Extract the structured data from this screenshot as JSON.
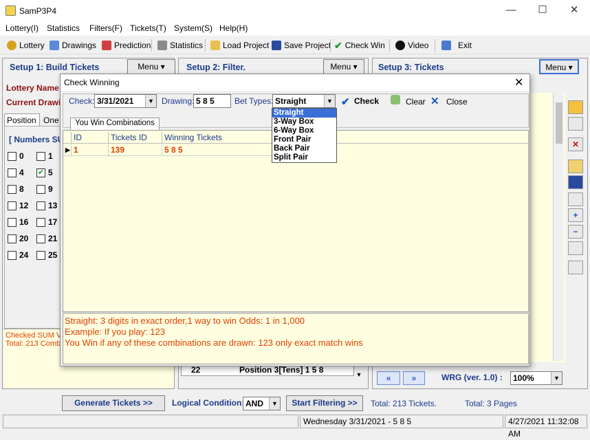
{
  "app": {
    "title": "SamP3P4"
  },
  "menu": [
    "Lottery(I)",
    "Statistics",
    "Filters(F)",
    "Tickets(T)",
    "System(S)",
    "Help(H)"
  ],
  "toolbar": [
    "Lottery",
    "Drawings",
    "Prediction",
    "Statistics",
    "Load Project",
    "Save Project",
    "Check Win",
    "Video",
    "Exit"
  ],
  "setup1": {
    "title": "Setup 1: Build  Tickets",
    "menu": "Menu ▾",
    "lottery_name": "Lottery  Name",
    "current_drawing": "Current Drawi",
    "tab_position": "Position",
    "tab_one": "One",
    "numbers_sum": "[ Numbers SU",
    "numbers": [
      "0",
      "1",
      "4",
      "5",
      "8",
      "9",
      "12",
      "13",
      "16",
      "17",
      "20",
      "21",
      "24",
      "25"
    ],
    "checked_index": 3,
    "note1": "Checked SUM V",
    "note2": "Total: 213 Comb"
  },
  "setup2": {
    "title": "Setup 2: Filter.",
    "menu": "Menu ▾",
    "row_num": "22",
    "row_text": "Position 3[Tens] 1 5 8"
  },
  "setup3": {
    "title": "Setup 3: Tickets",
    "menu": "Menu ▾",
    "version": "WRG (ver. 1.0) :",
    "zoom": "100%"
  },
  "dialog": {
    "title": "Check Winning",
    "check_label": "Check:",
    "check_date": "3/31/2021",
    "drawing_label": "Drawing:",
    "drawing_value": "5 8 5",
    "bet_label": "Bet Types:",
    "bet_value": "Straight",
    "check_btn": "Check",
    "clear_btn": "Clear",
    "close_btn": "Close",
    "tab": "You Win Combinations",
    "columns": [
      "ID",
      "Tickets ID",
      "Winning Tickets"
    ],
    "rows": [
      {
        "id": "1",
        "ticket": "139",
        "win": "5 8 5"
      }
    ],
    "bet_options": [
      "Straight",
      "3-Way Box",
      "6-Way Box",
      "Front Pair",
      "Back Pair",
      "Split Pair"
    ],
    "info": [
      "Straight: 3 digits in exact order,1 way to win Odds: 1 in 1,000",
      "Example: If you play: 123",
      "You Win if any of these combinations are drawn: 123 only exact match wins"
    ]
  },
  "bottom": {
    "generate": "Generate Tickets >>",
    "logical_label": "Logical Condition:",
    "logical_value": "AND",
    "start_filter": "Start Filtering  >>",
    "total_tickets": "Total: 213 Tickets.",
    "total_pages": "Total: 3 Pages"
  },
  "status": {
    "drawing": "Wednesday 3/31/2021 - 5 8 5",
    "datetime": "4/27/2021 11:32:08 AM"
  },
  "colors": {
    "accent": "#1a3a8c",
    "highlight": "#e04000",
    "select": "#3a6fd8"
  }
}
